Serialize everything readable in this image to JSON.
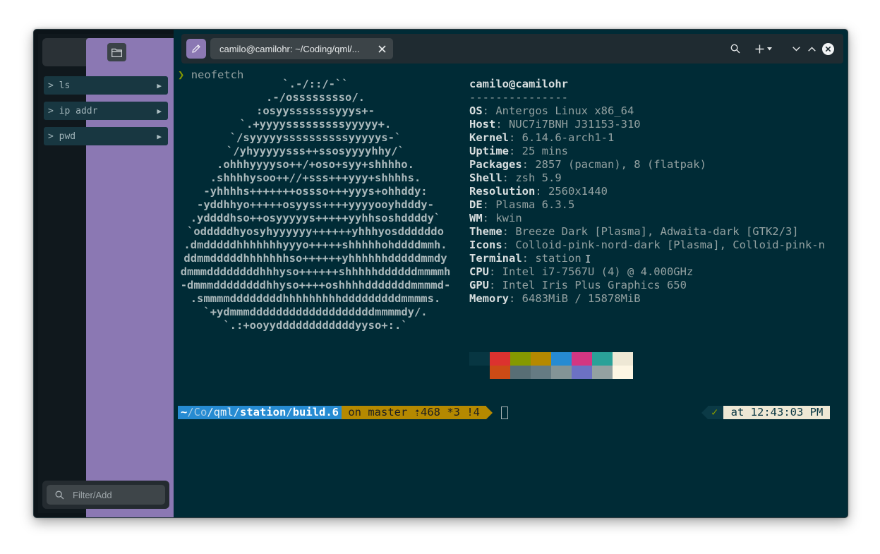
{
  "sidebar": {
    "commands": [
      {
        "label": "> ls"
      },
      {
        "label": "> ip addr"
      },
      {
        "label": "> pwd"
      }
    ],
    "filter_placeholder": "Filter/Add"
  },
  "tab": {
    "title": "camilo@camilohr: ~/Coding/qml/..."
  },
  "terminal": {
    "command_prompt": "❯",
    "command": "neofetch",
    "ascii_art": [
      "`.-/::/-``",
      ".-/osssssssso/.",
      ":osyysssssssyyys+-",
      "`.+yyyysssssssssyyyyy+.",
      "`/syyyyyssssssssssyyyyys-`",
      "`/yhyyyyysss++ssosyyyyhhy/`",
      ".ohhhyyyyso++/+oso+syy+shhhho.",
      ".shhhhysoo++//+sss+++yyy+shhhhs.",
      "-yhhhhs+++++++ossso+++yyys+ohhddy:",
      "-yddhhyo+++++osyyss++++yyyyooyhdddy-",
      ".yddddhso++osyyyyys+++++yyhhsoshddddy`",
      "`odddddhyosyhyyyyyy++++++yhhhyosddddddo",
      ".dmdddddhhhhhhhyyyo+++++shhhhhohddddmmh.",
      "ddmmdddddhhhhhhhso++++++yhhhhhhdddddmmdy",
      "dmmmddddddddhhhyso++++++shhhhhddddddmmmmh",
      "-dmmmddddddddhhyso++++oshhhhdddddddmmmmd-",
      ".smmmmddddddddhhhhhhhhhdddddddddmmmms.",
      "`+ydmmmdddddddddddddddddddmmmmdy/.",
      "`.:+ooyyddddddddddddyyso+:.`"
    ],
    "user_host": "camilo@camilohr",
    "separator": "---------------",
    "info": [
      {
        "key": "OS",
        "value": "Antergos Linux x86_64"
      },
      {
        "key": "Host",
        "value": "NUC7i7BNH J31153-310"
      },
      {
        "key": "Kernel",
        "value": "6.14.6-arch1-1"
      },
      {
        "key": "Uptime",
        "value": "25 mins"
      },
      {
        "key": "Packages",
        "value": "2857 (pacman), 8 (flatpak)"
      },
      {
        "key": "Shell",
        "value": "zsh 5.9"
      },
      {
        "key": "Resolution",
        "value": "2560x1440"
      },
      {
        "key": "DE",
        "value": "Plasma 6.3.5"
      },
      {
        "key": "WM",
        "value": "kwin"
      },
      {
        "key": "Theme",
        "value": "Breeze Dark [Plasma], Adwaita-dark [GTK2/3]"
      },
      {
        "key": "Icons",
        "value": "Colloid-pink-nord-dark [Plasma], Colloid-pink-n"
      },
      {
        "key": "Terminal",
        "value": "station"
      },
      {
        "key": "CPU",
        "value": "Intel i7-7567U (4) @ 4.000GHz"
      },
      {
        "key": "GPU",
        "value": "Intel Iris Plus Graphics 650"
      },
      {
        "key": "Memory",
        "value": "6483MiB / 15878MiB"
      }
    ],
    "palette_row1": [
      "#073642",
      "#dc322f",
      "#859900",
      "#b58900",
      "#268bd2",
      "#d33682",
      "#2aa198",
      "#eee8d5"
    ],
    "palette_row2": [
      "#002b36",
      "#cb4b16",
      "#586e75",
      "#657b83",
      "#839496",
      "#6c71c4",
      "#93a1a1",
      "#fdf6e3"
    ],
    "prompt": {
      "path_home": "~",
      "path_co": "/Co",
      "path_qml": "/qml/",
      "path_station": "station",
      "path_slash": "/",
      "path_build": "build.6",
      "git": " on master ⇡468 *3 !4 ",
      "status": "✓",
      "time": " at 12:43:03 PM "
    }
  }
}
